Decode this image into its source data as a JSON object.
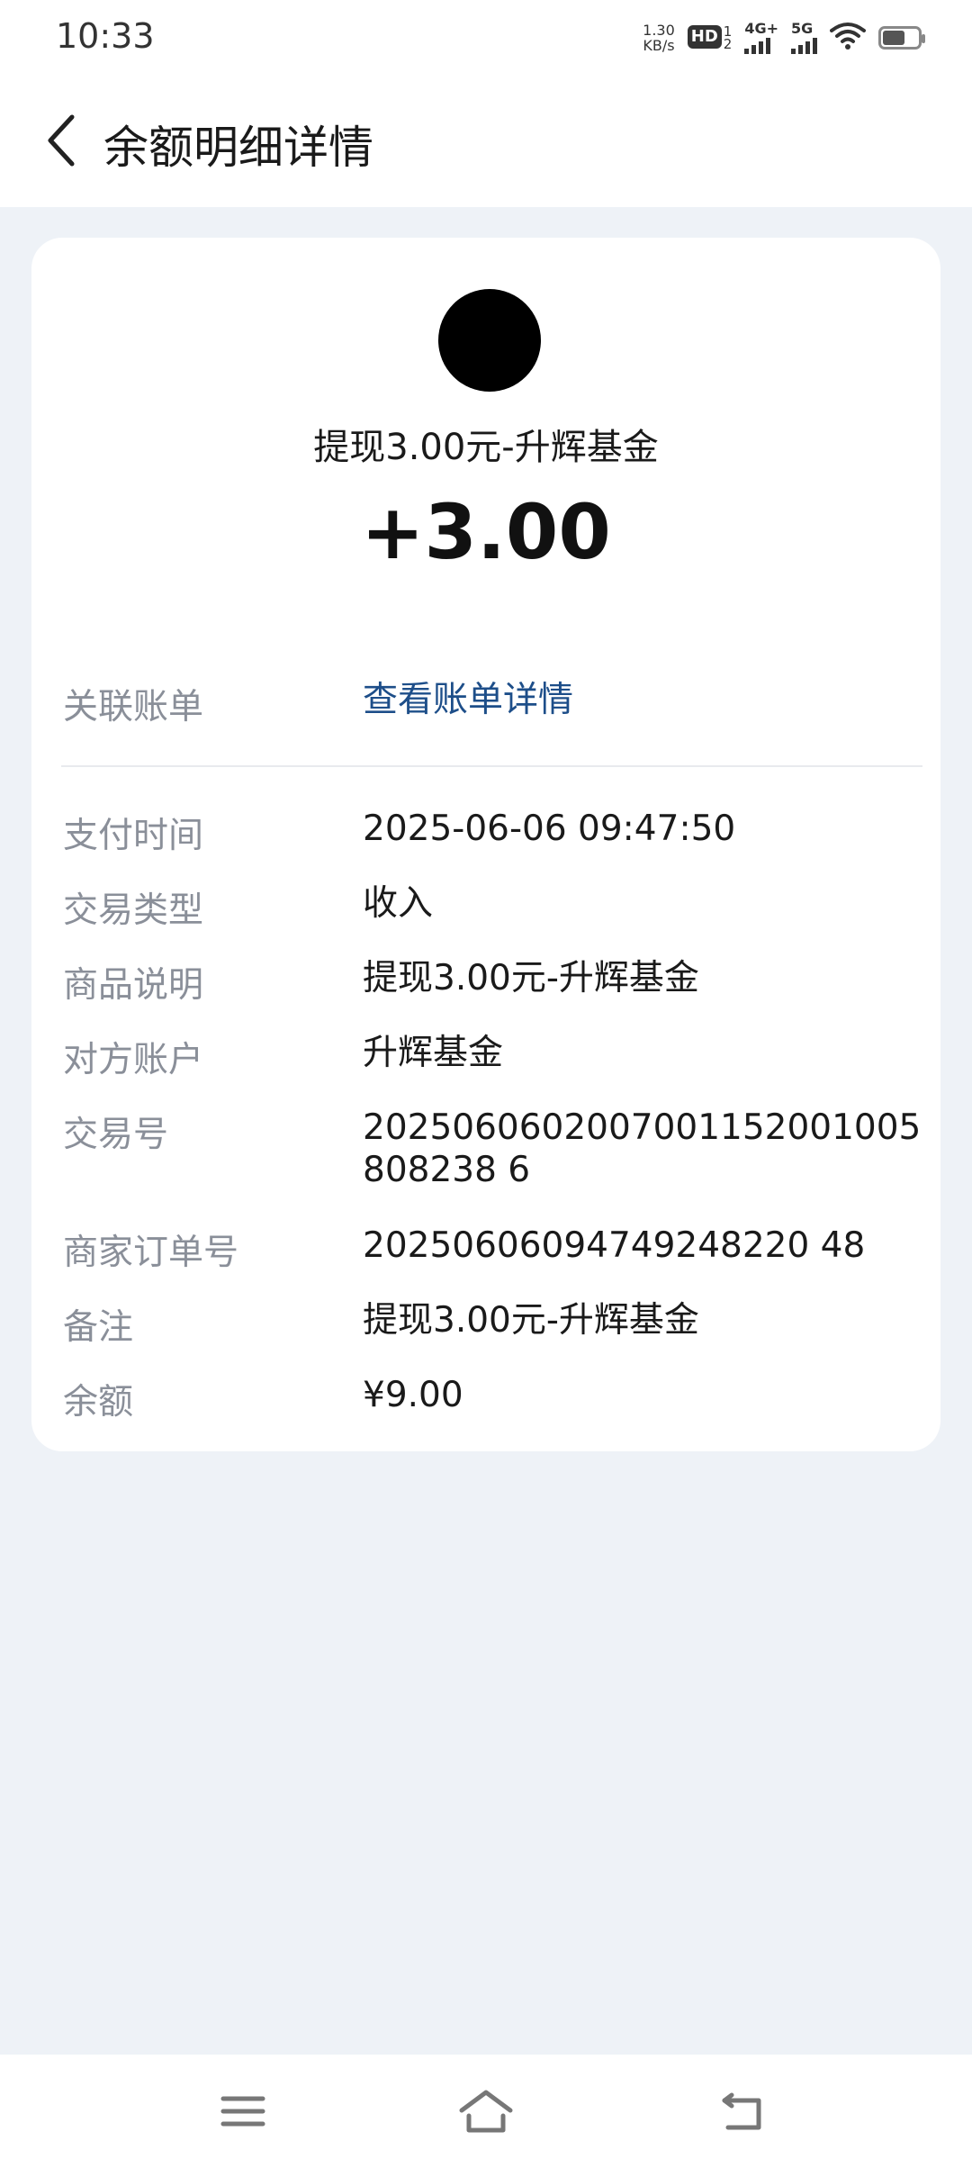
{
  "status_bar": {
    "time": "10:33",
    "net_speed_value": "1.30",
    "net_speed_unit": "KB/s",
    "hd_label": "HD",
    "hd_sub_top": "1",
    "hd_sub_bottom": "2",
    "signal1_label": "4G+",
    "signal2_label": "5G"
  },
  "header": {
    "title": "余额明细详情"
  },
  "transaction": {
    "title": "提现3.00元-升辉基金",
    "amount": "+3.00"
  },
  "linked_bill": {
    "label": "关联账单",
    "value": "查看账单详情"
  },
  "details": [
    {
      "label": "支付时间",
      "value": "2025-06-06 09:47:50"
    },
    {
      "label": "交易类型",
      "value": "收入"
    },
    {
      "label": "商品说明",
      "value": "提现3.00元-升辉基金"
    },
    {
      "label": "对方账户",
      "value": "升辉基金"
    },
    {
      "label": "交易号",
      "value": "2025060602007001152001005808238 6"
    },
    {
      "label": "商家订单号",
      "value": "20250606094749248220 48"
    },
    {
      "label": "备注",
      "value": "提现3.00元-升辉基金"
    },
    {
      "label": "余额",
      "value": "¥9.00"
    }
  ],
  "colors": {
    "page_bg": "#eef2f7",
    "card_bg": "#ffffff",
    "label": "#8a8f99",
    "link": "#1d4e89"
  }
}
